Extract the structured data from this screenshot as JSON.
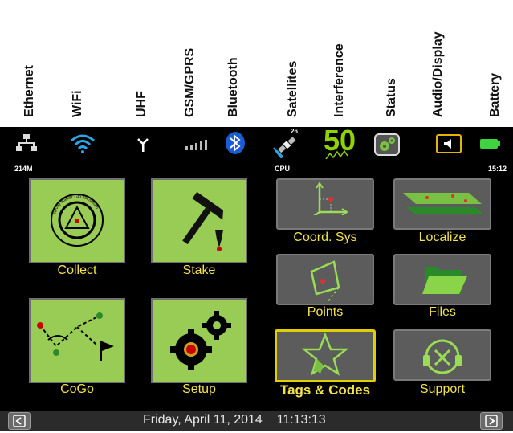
{
  "annotation_labels": [
    "Ethernet",
    "WiFi",
    "UHF",
    "GSM/GPRS",
    "Bluetooth",
    "Satellites",
    "Interference",
    "Status",
    "Audio/Display",
    "Battery"
  ],
  "status": {
    "memory": "214M",
    "cpu": "CPU",
    "satellites_count": "26",
    "interference_value": "50",
    "clock": "15:12"
  },
  "tiles": {
    "collect": "Collect",
    "stake": "Stake",
    "cogo": "CoGo",
    "setup": "Setup",
    "coord_sys": "Coord. Sys",
    "localize": "Localize",
    "points": "Points",
    "files": "Files",
    "tags_codes": "Tags & Codes",
    "support": "Support"
  },
  "collect_seal_text": "survey marker - do not disturb",
  "datetime": "Friday, April 11, 2014    11:13:13",
  "colors": {
    "tile_green": "#99cc55",
    "label_yellow": "#f2e24c",
    "selection": "#e0d000",
    "bluetooth": "#1a5bd6"
  },
  "icons": [
    "ethernet-icon",
    "wifi-icon",
    "uhf-antenna-icon",
    "gsm-signal-icon",
    "bluetooth-icon",
    "satellite-icon",
    "interference-icon",
    "status-gears-icon",
    "speaker-icon",
    "battery-icon"
  ]
}
